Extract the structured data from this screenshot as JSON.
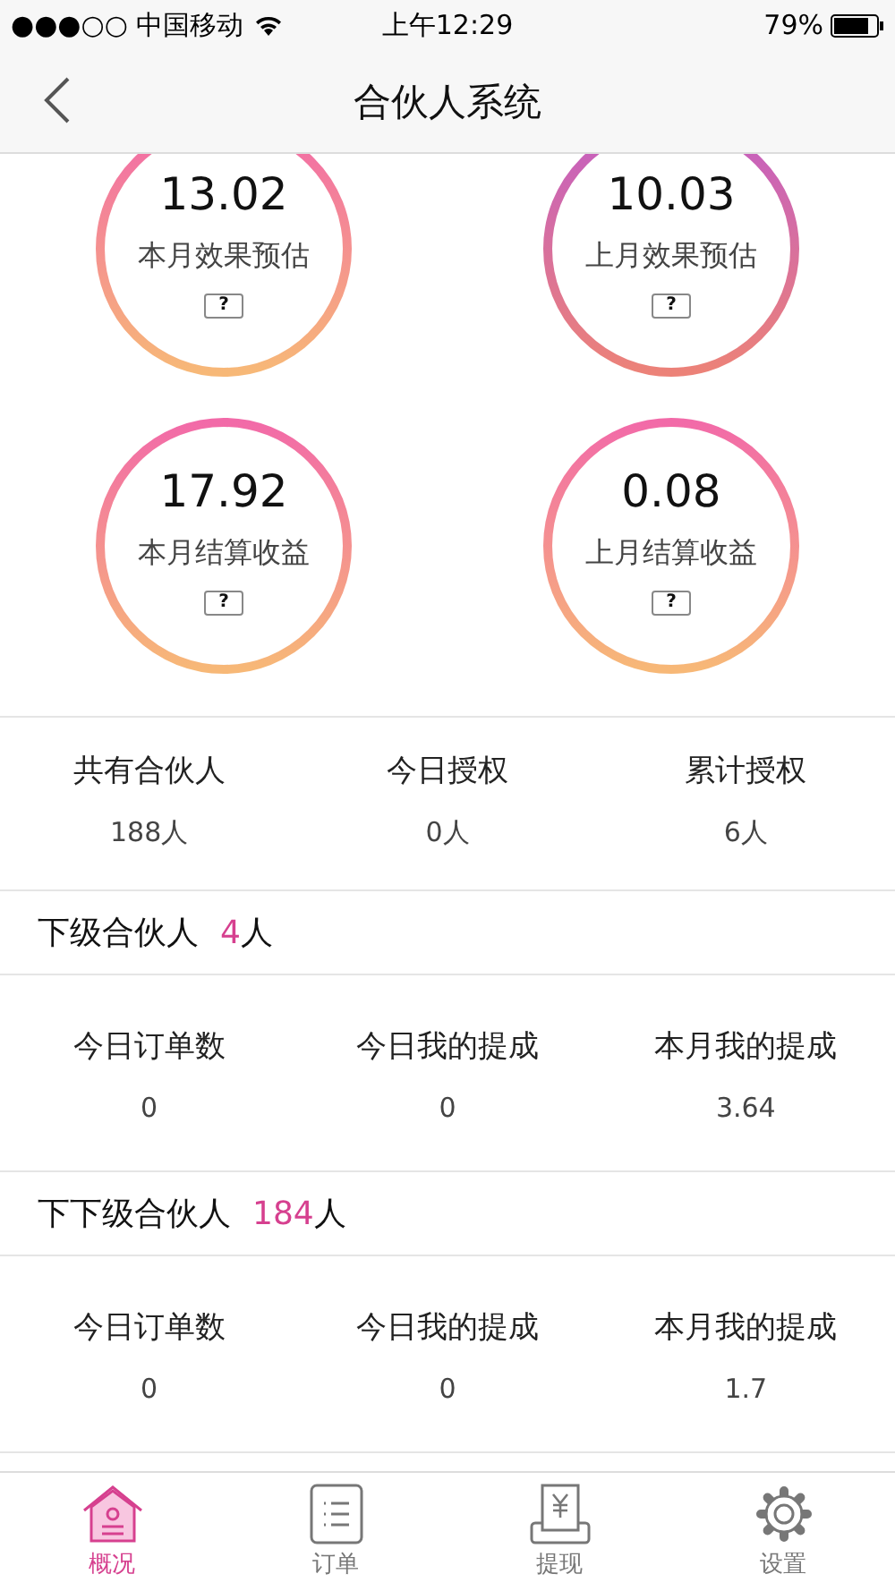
{
  "status_bar": {
    "carrier": "●●●○○ 中国移动",
    "time": "上午12:29",
    "battery": "79%"
  },
  "nav": {
    "title": "合伙人系统"
  },
  "rings": [
    {
      "value": "13.02",
      "label": "本月效果预估",
      "help": "?"
    },
    {
      "value": "10.03",
      "label": "上月效果预估",
      "help": "?"
    },
    {
      "value": "17.92",
      "label": "本月结算收益",
      "help": "?"
    },
    {
      "value": "0.08",
      "label": "上月结算收益",
      "help": "?"
    }
  ],
  "summary": [
    {
      "label": "共有合伙人",
      "value": "188人"
    },
    {
      "label": "今日授权",
      "value": "0人"
    },
    {
      "label": "累计授权",
      "value": "6人"
    }
  ],
  "groups": [
    {
      "title": "下级合伙人",
      "count": "4",
      "unit": "人",
      "stats": [
        {
          "label": "今日订单数",
          "value": "0"
        },
        {
          "label": "今日我的提成",
          "value": "0"
        },
        {
          "label": "本月我的提成",
          "value": "3.64"
        }
      ]
    },
    {
      "title": "下下级合伙人",
      "count": "184",
      "unit": "人",
      "stats": [
        {
          "label": "今日订单数",
          "value": "0"
        },
        {
          "label": "今日我的提成",
          "value": "0"
        },
        {
          "label": "本月我的提成",
          "value": "1.7"
        }
      ]
    }
  ],
  "tabs": [
    {
      "kind": "home",
      "label": "概况",
      "selected": true
    },
    {
      "kind": "list",
      "label": "订单",
      "selected": false
    },
    {
      "kind": "yuan",
      "label": "提现",
      "selected": false
    },
    {
      "kind": "gear",
      "label": "设置",
      "selected": false
    }
  ]
}
